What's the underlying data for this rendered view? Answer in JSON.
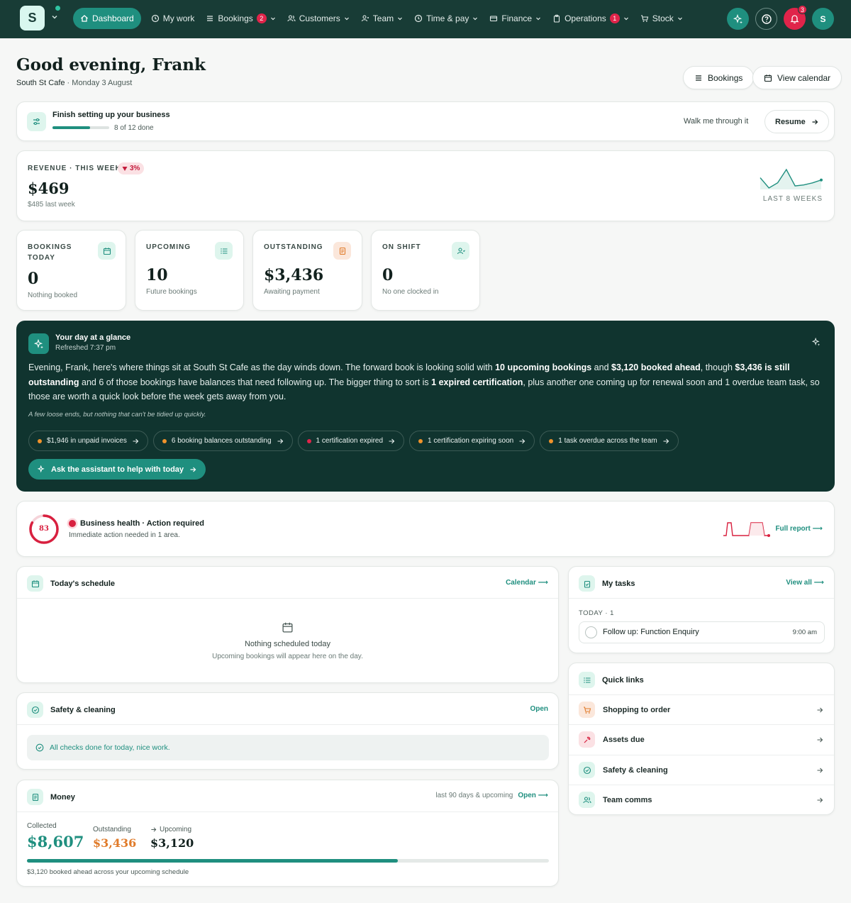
{
  "nav": {
    "logo_letter": "S",
    "items": [
      {
        "label": "Dashboard",
        "icon": "home-icon"
      },
      {
        "label": "My work",
        "icon": "clock-icon"
      },
      {
        "label": "Bookings",
        "icon": "list-icon",
        "badge": "2"
      },
      {
        "label": "Customers",
        "icon": "users-icon"
      },
      {
        "label": "Team",
        "icon": "user-icon"
      },
      {
        "label": "Time & pay",
        "icon": "clock-icon"
      },
      {
        "label": "Finance",
        "icon": "card-icon"
      },
      {
        "label": "Operations",
        "icon": "clipboard-icon",
        "badge": "1"
      },
      {
        "label": "Stock",
        "icon": "cart-icon"
      }
    ],
    "notification_count": "3",
    "avatar_letter": "S"
  },
  "header": {
    "greeting": "Good evening, Frank",
    "business": "South St Cafe",
    "date": "Monday 3 August",
    "bookings_btn": "Bookings",
    "calendar_btn": "View calendar"
  },
  "setup": {
    "title": "Finish setting up your business",
    "progress": "8 of 12 done",
    "progress_fraction": 0.667,
    "walk_label": "Walk me through it",
    "resume_label": "Resume"
  },
  "revenue": {
    "label": "REVENUE · THIS WEEK",
    "change": "3%",
    "value": "$469",
    "last_week": "$485 last week",
    "spark_label": "LAST 8 WEEKS",
    "spark_values": [
      480,
      430,
      455,
      520,
      440,
      445,
      455,
      469
    ]
  },
  "stats": [
    {
      "label": "BOOKINGS TODAY",
      "value": "0",
      "sub": "Nothing booked",
      "icon": "calendar-icon"
    },
    {
      "label": "UPCOMING",
      "value": "10",
      "sub": "Future bookings",
      "icon": "list-icon"
    },
    {
      "label": "OUTSTANDING",
      "value": "$3,436",
      "sub": "Awaiting payment",
      "icon": "invoice-icon"
    },
    {
      "label": "ON SHIFT",
      "value": "0",
      "sub": "No one clocked in",
      "icon": "user-icon"
    }
  ],
  "glance": {
    "title": "Your day at a glance",
    "refreshed": "Refreshed 7:37 pm",
    "p1": "Evening, Frank, here's where things sit at South St Cafe as the day winds down. The forward book is looking solid with ",
    "b1": "10 upcoming bookings",
    "p2": " and ",
    "b2": "$3,120 booked ahead",
    "p3": ", though ",
    "b3": "$3,436 is still outstanding",
    "p4": " and 6 of those bookings have balances that need following up. The bigger thing to sort is ",
    "b4": "1 expired certification",
    "p5": ", plus another one coming up for renewal soon and 1 overdue team task, so those are worth a quick look before the week gets away from you.",
    "note": "A few loose ends, but nothing that can't be tidied up quickly.",
    "chips": [
      {
        "label": "$1,946 in unpaid invoices",
        "color": "#f0932b"
      },
      {
        "label": "6 booking balances outstanding",
        "color": "#f0932b"
      },
      {
        "label": "1 certification expired",
        "color": "#e0244a"
      },
      {
        "label": "1 certification expiring soon",
        "color": "#f0932b"
      },
      {
        "label": "1 task overdue across the team",
        "color": "#f0932b"
      }
    ],
    "ask_label": "Ask the assistant to help with today"
  },
  "health": {
    "score": "83",
    "score_fraction": 0.83,
    "title": "Business health · Action required",
    "sub": "Immediate action needed in 1 area.",
    "report_link": "Full report ⟶"
  },
  "schedule": {
    "title": "Today's schedule",
    "link": "Calendar ⟶",
    "empty_title": "Nothing scheduled today",
    "empty_sub": "Upcoming bookings will appear here on the day."
  },
  "tasks": {
    "title": "My tasks",
    "link": "View all ⟶",
    "group": "TODAY · 1",
    "items": [
      {
        "label": "Follow up: Function Enquiry",
        "time": "9:00 am"
      }
    ]
  },
  "safety": {
    "title": "Safety & cleaning",
    "link": "Open",
    "message": "All checks done for today, nice work."
  },
  "quicklinks": {
    "title": "Quick links",
    "items": [
      {
        "label": "Shopping to order",
        "icon": "cart-icon"
      },
      {
        "label": "Assets due",
        "icon": "wrench-icon"
      },
      {
        "label": "Safety & cleaning",
        "icon": "check-circle-icon"
      },
      {
        "label": "Team comms",
        "icon": "users-icon"
      }
    ]
  },
  "money": {
    "title": "Money",
    "range": "last 90 days & upcoming",
    "link": "Open ⟶",
    "collected_label": "Collected",
    "collected": "$8,607",
    "outstanding_label": "Outstanding",
    "outstanding": "$3,436",
    "upcoming_label": "Upcoming",
    "upcoming": "$3,120",
    "bar_fraction": 0.71,
    "footnote": "$3,120 booked ahead across your upcoming schedule"
  },
  "colors": {
    "brand": "#183c36",
    "accent": "#1f8f7f",
    "danger": "#e0244a",
    "warning": "#f0932b"
  }
}
